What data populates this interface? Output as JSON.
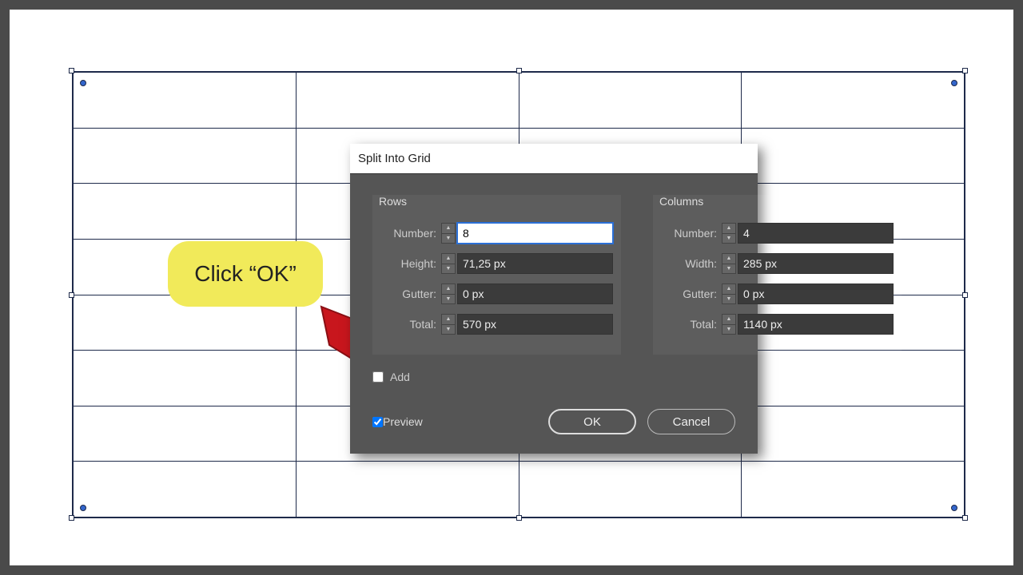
{
  "grid": {
    "rows": 8,
    "cols": 4
  },
  "callout": {
    "text": "Click “OK”"
  },
  "dialog": {
    "title": "Split Into Grid",
    "rows": {
      "title": "Rows",
      "number_label": "Number:",
      "number_value": "8",
      "height_label": "Height:",
      "height_value": "71,25 px",
      "gutter_label": "Gutter:",
      "gutter_value": "0 px",
      "total_label": "Total:",
      "total_value": "570 px"
    },
    "columns": {
      "title": "Columns",
      "number_label": "Number:",
      "number_value": "4",
      "width_label": "Width:",
      "width_value": "285 px",
      "gutter_label": "Gutter:",
      "gutter_value": "0 px",
      "total_label": "Total:",
      "total_value": "1140 px"
    },
    "add_guides_label": "Add",
    "preview_label": "Preview",
    "preview_checked": true,
    "ok_label": "OK",
    "cancel_label": "Cancel"
  }
}
